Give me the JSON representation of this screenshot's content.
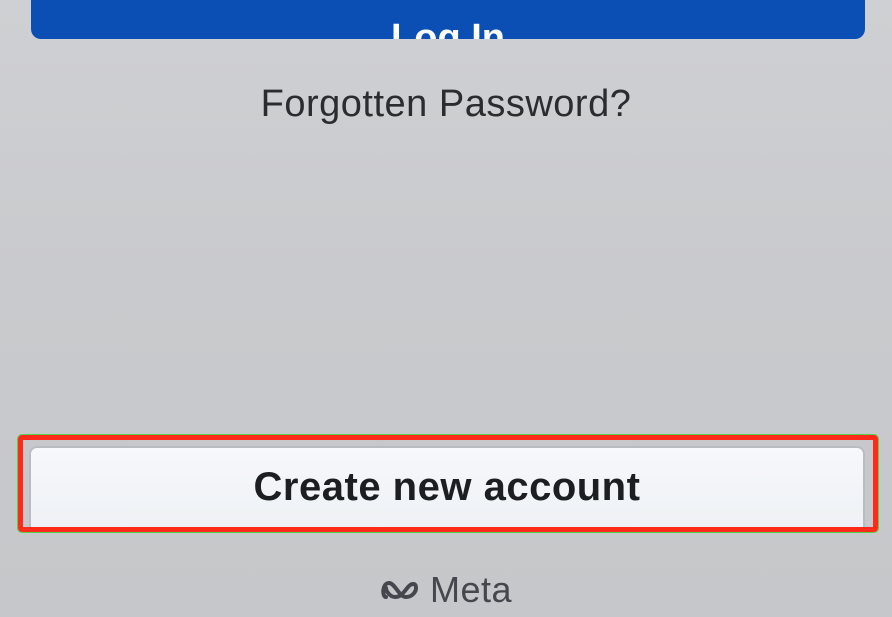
{
  "login": {
    "label": "Log In"
  },
  "forgot": {
    "label": "Forgotten Password?"
  },
  "create_account": {
    "label": "Create new account"
  },
  "brand": {
    "icon": "meta-infinity-icon",
    "label": "Meta"
  },
  "colors": {
    "background": "#c9cacd",
    "primary_button": "#0b4fb5",
    "highlight": "#ff2a1a",
    "text": "#2a2c30"
  }
}
